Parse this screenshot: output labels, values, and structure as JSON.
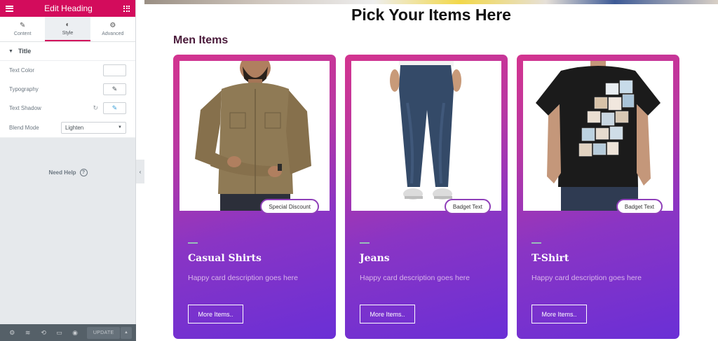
{
  "panel": {
    "header_title": "Edit Heading",
    "tabs": [
      {
        "label": "Content",
        "icon": "pencil-icon"
      },
      {
        "label": "Style",
        "icon": "half-circle-icon"
      },
      {
        "label": "Advanced",
        "icon": "gear-icon"
      }
    ],
    "section_title": "Title",
    "controls": {
      "text_color": "Text Color",
      "typography": "Typography",
      "text_shadow": "Text Shadow",
      "blend_mode": "Blend Mode",
      "blend_mode_value": "Lighten"
    },
    "need_help": "Need Help",
    "update_label": "UPDATE",
    "accent_color": "#d30c5c"
  },
  "page": {
    "title": "Pick Your Items Here",
    "section_title": "Men Items",
    "cards": [
      {
        "badge": "Special Discount",
        "title": "Casual Shirts",
        "description": "Happy card description goes here",
        "button": "More Items.."
      },
      {
        "badge": "Badget Text",
        "title": "Jeans",
        "description": "Happy card description goes here",
        "button": "More Items.."
      },
      {
        "badge": "Badget Text",
        "title": "T-Shirt",
        "description": "Happy card description goes here",
        "button": "More Items.."
      }
    ]
  }
}
